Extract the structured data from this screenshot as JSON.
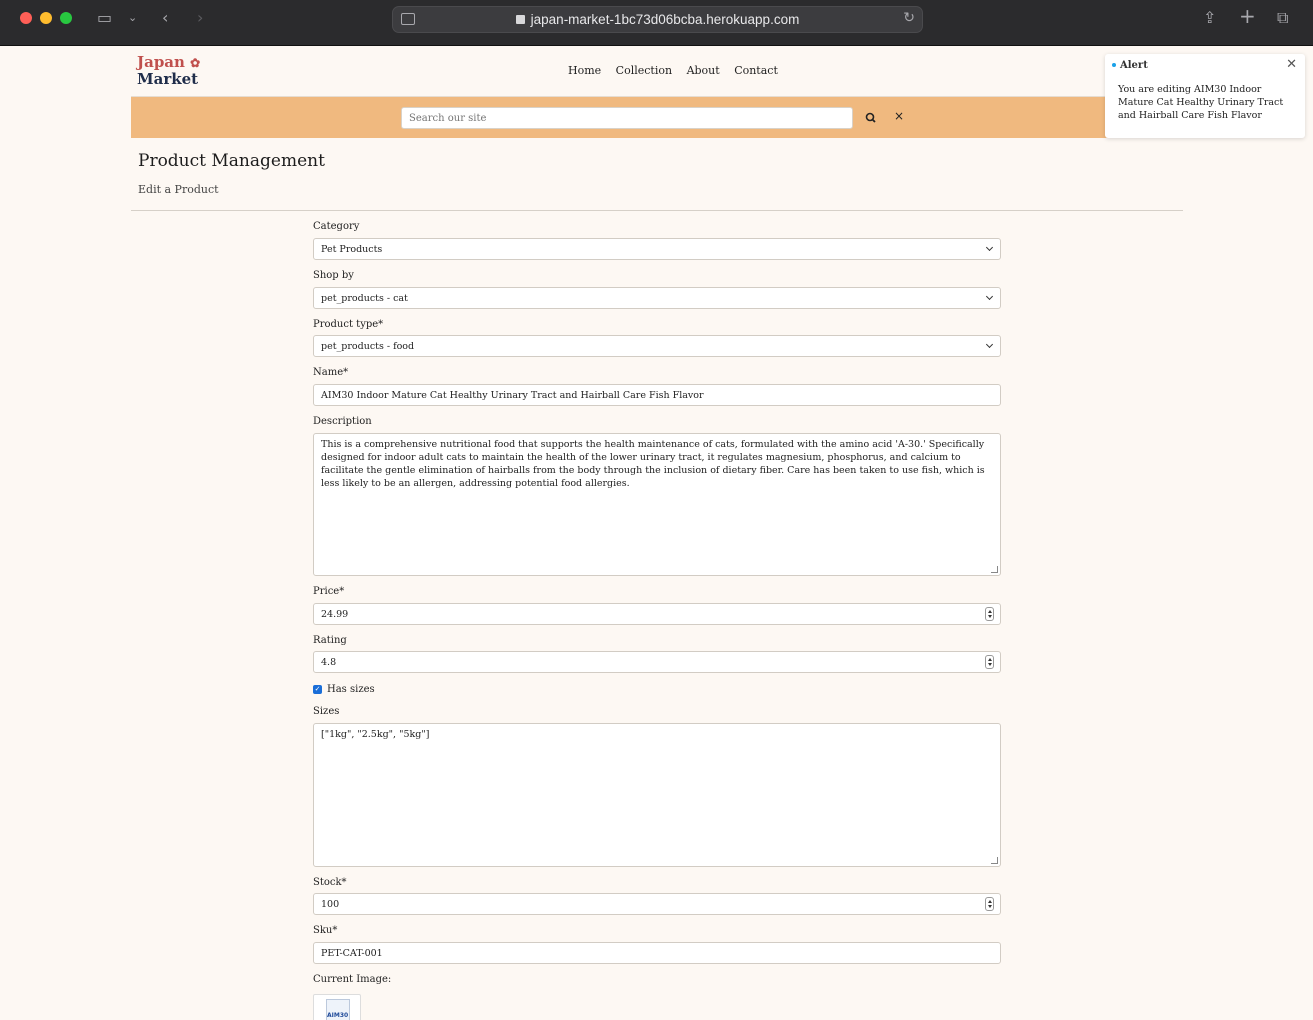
{
  "browser": {
    "url": "japan-market-1bc73d06bcba.herokuapp.com"
  },
  "site": {
    "logo_line1": "Japan",
    "logo_line2": "Market",
    "nav": [
      "Home",
      "Collection",
      "About",
      "Contact"
    ],
    "search_placeholder": "Search our site",
    "clear_label": "×"
  },
  "page": {
    "title": "Product Management",
    "subtitle": "Edit a Product"
  },
  "form": {
    "category_label": "Category",
    "category_value": "Pet Products",
    "shopby_label": "Shop by",
    "shopby_value": "pet_products - cat",
    "ptype_label": "Product type*",
    "ptype_value": "pet_products - food",
    "name_label": "Name*",
    "name_value": "AIM30 Indoor Mature Cat Healthy Urinary Tract and Hairball Care Fish Flavor",
    "description_label": "Description",
    "description_value": "This is a comprehensive nutritional food that supports the health maintenance of cats, formulated with the amino acid 'A-30.' Specifically designed for indoor adult cats to maintain the health of the lower urinary tract, it regulates magnesium, phosphorus, and calcium to facilitate the gentle elimination of hairballs from the body through the inclusion of dietary fiber. Care has been taken to use fish, which is less likely to be an allergen, addressing potential food allergies.",
    "price_label": "Price*",
    "price_value": "24.99",
    "rating_label": "Rating",
    "rating_value": "4.8",
    "has_sizes_label": "Has sizes",
    "sizes_label": "Sizes",
    "sizes_value": "[\"1kg\", \"2.5kg\", \"5kg\"]",
    "stock_label": "Stock*",
    "stock_value": "100",
    "sku_label": "Sku*",
    "sku_value": "PET-CAT-001",
    "current_image_label": "Current Image:",
    "image_text": "AIM30"
  },
  "alert": {
    "title": "Alert",
    "message": "You are editing AIM30 Indoor Mature Cat Healthy Urinary Tract and Hairball Care Fish Flavor"
  },
  "colors": {
    "search_band": "#f0b97f",
    "background": "#fdf8f3",
    "logo_red": "#c0504d",
    "logo_navy": "#1f2d4a",
    "checkbox_blue": "#1a6ed8"
  }
}
